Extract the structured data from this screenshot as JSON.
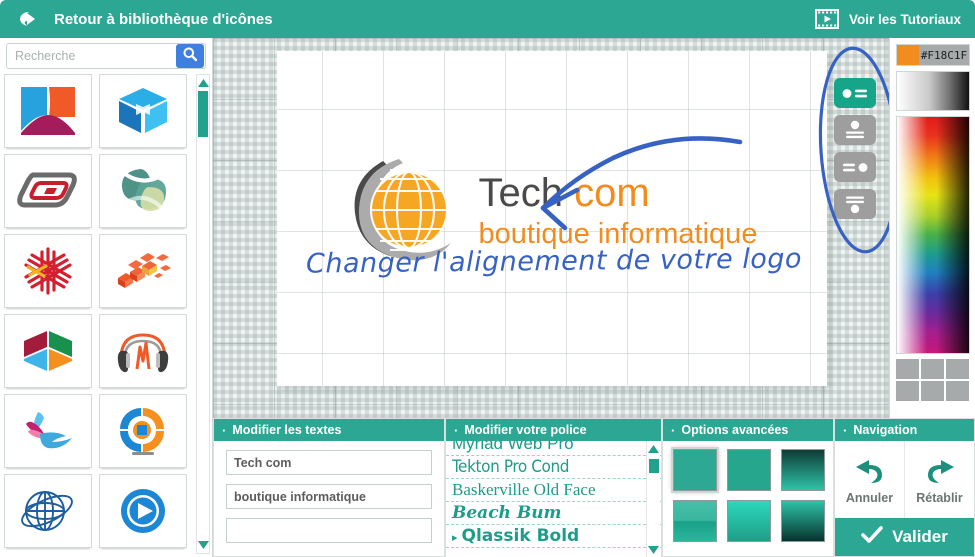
{
  "header": {
    "back_label": "Retour à bibliothèque d'icônes",
    "back_icon": "back-arrow-icon",
    "tutorial_label": "Voir les Tutoriaux",
    "tutorial_icon": "film-play-icon",
    "bg_color": "#2BA794"
  },
  "library": {
    "search": {
      "placeholder": "Recherche",
      "value": "",
      "button_icon": "search-icon"
    },
    "icons": [
      {
        "name": "icon-abstract-shield"
      },
      {
        "name": "icon-blue-cube"
      },
      {
        "name": "icon-red-loop"
      },
      {
        "name": "icon-green-atom"
      },
      {
        "name": "icon-red-snowflake"
      },
      {
        "name": "icon-orange-blocks"
      },
      {
        "name": "icon-color-hexagon"
      },
      {
        "name": "icon-orange-headphones"
      },
      {
        "name": "icon-pink-hummingbird"
      },
      {
        "name": "icon-orange-target"
      },
      {
        "name": "icon-blue-globe"
      },
      {
        "name": "icon-blue-play"
      }
    ],
    "scrollbar": {
      "up_icon": "triangle-up-icon",
      "down_icon": "triangle-down-icon"
    }
  },
  "canvas": {
    "logo": {
      "icon_name": "orange-globe-swoosh-icon",
      "line1_part1": "Tech ",
      "line1_part2": "com",
      "line2": "boutique informatique",
      "color_dark": "#4A4A4A",
      "color_orange": "#F18C1F"
    },
    "annotation_text": "Changer l'alignement de votre logo",
    "annotation_color": "#3762C4",
    "alignment_buttons": [
      {
        "name": "align-icon-left-text-right",
        "active": true
      },
      {
        "name": "align-icon-top-centered",
        "active": false
      },
      {
        "name": "align-text-left-icon-right",
        "active": false
      },
      {
        "name": "align-text-top-icon-bottom",
        "active": false
      }
    ]
  },
  "color_panel": {
    "hex_value": "#F18C1F",
    "swatch_color": "#F18C1F",
    "gray_ramp": "gray-gradient-bar",
    "spectrum": "color-spectrum",
    "recent_swatches": [
      "#A6AAAB",
      "#A6AAAB",
      "#A6AAAB",
      "#A6AAAB",
      "#A6AAAB",
      "#A6AAAB"
    ]
  },
  "panels": {
    "textes": {
      "title": "Modifier les textes",
      "fields": [
        {
          "name": "logo-text-line-1",
          "value": "Tech com",
          "placeholder": ""
        },
        {
          "name": "logo-text-line-2",
          "value": "boutique informatique",
          "placeholder": ""
        },
        {
          "name": "logo-text-line-3",
          "value": "",
          "placeholder": ""
        }
      ]
    },
    "police": {
      "title": "Modifier votre police",
      "fonts": [
        {
          "label": "Myriad Web Pro",
          "selected": false
        },
        {
          "label": "Tekton Pro Cond",
          "selected": false
        },
        {
          "label": "Baskerville Old Face",
          "selected": false
        },
        {
          "label": "Beach Bum",
          "selected": false
        },
        {
          "label": "Qlassik Bold",
          "selected": true,
          "caret": "▸"
        }
      ]
    },
    "options": {
      "title": "Options avancées",
      "styles": [
        {
          "name": "style-flat-teal",
          "css": "linear-gradient(to bottom,#2CA893,#2CA893)",
          "selected": true
        },
        {
          "name": "style-solid-teal",
          "css": "linear-gradient(to bottom,#27A68E,#27A68E)",
          "selected": false
        },
        {
          "name": "style-dark-to-teal",
          "css": "linear-gradient(to bottom,#0D3C36,#2FC3A6)",
          "selected": false
        },
        {
          "name": "style-split-teal",
          "css": "linear-gradient(to bottom,#45BFA8 0%,#3AB79F 48%,#18A188 52%,#2BB69C 100%)",
          "selected": false
        },
        {
          "name": "style-bright-teal",
          "css": "linear-gradient(to bottom,#2DD8BC,#1F9E88)",
          "selected": false
        },
        {
          "name": "style-teal-to-dark",
          "css": "linear-gradient(to bottom,#2FC2A6,#07332E)",
          "selected": false
        }
      ]
    },
    "navigation": {
      "title": "Navigation",
      "undo_label": "Annuler",
      "undo_icon": "undo-arrow-icon",
      "redo_label": "Rétablir",
      "redo_icon": "redo-arrow-icon",
      "validate_label": "Valider",
      "validate_icon": "check-icon"
    }
  }
}
